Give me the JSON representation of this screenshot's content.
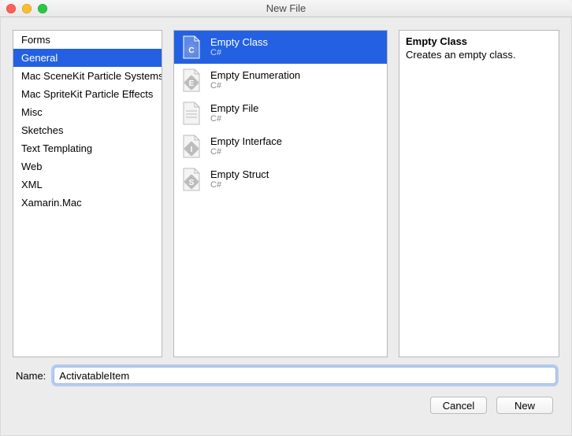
{
  "window": {
    "title": "New File"
  },
  "categories": [
    {
      "label": "Forms",
      "selected": false
    },
    {
      "label": "General",
      "selected": true
    },
    {
      "label": "Mac SceneKit Particle Systems",
      "selected": false
    },
    {
      "label": "Mac SpriteKit Particle Effects",
      "selected": false
    },
    {
      "label": "Misc",
      "selected": false
    },
    {
      "label": "Sketches",
      "selected": false
    },
    {
      "label": "Text Templating",
      "selected": false
    },
    {
      "label": "Web",
      "selected": false
    },
    {
      "label": "XML",
      "selected": false
    },
    {
      "label": "Xamarin.Mac",
      "selected": false
    }
  ],
  "templates": [
    {
      "name": "Empty Class",
      "lang": "C#",
      "icon": "C",
      "selected": true
    },
    {
      "name": "Empty Enumeration",
      "lang": "C#",
      "icon": "E",
      "selected": false
    },
    {
      "name": "Empty File",
      "lang": "C#",
      "icon": "file",
      "selected": false
    },
    {
      "name": "Empty Interface",
      "lang": "C#",
      "icon": "I",
      "selected": false
    },
    {
      "name": "Empty Struct",
      "lang": "C#",
      "icon": "S",
      "selected": false
    }
  ],
  "description": {
    "title": "Empty Class",
    "body": "Creates an empty class."
  },
  "name_row": {
    "label": "Name:",
    "value": "ActivatableItem"
  },
  "buttons": {
    "cancel": "Cancel",
    "new": "New"
  }
}
